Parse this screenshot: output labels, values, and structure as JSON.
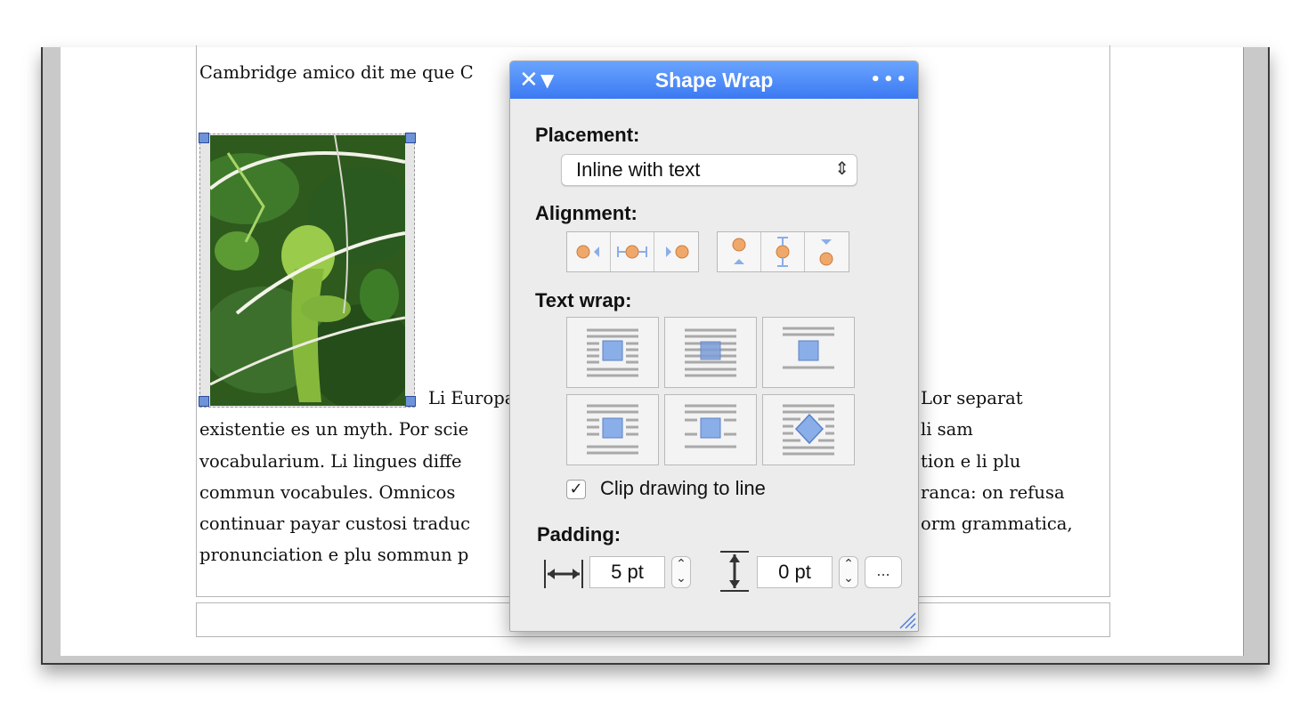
{
  "document": {
    "line_partial_top": "Cambridge amico dit me que C",
    "line_1": "Li Europa",
    "line_1_right": "Lor separat",
    "line_2": "existentie es un myth. Por scie",
    "line_2_right": "li sam",
    "line_3": "vocabularium. Li lingues diffe",
    "line_3_right": "tion e li plu",
    "line_4": "commun vocabules. Omnicos",
    "line_4_right": "ranca: on refusa",
    "line_5": "continuar payar custosi traduc",
    "line_5_right": "orm grammatica,",
    "line_6": "pronunciation e plu sommun p"
  },
  "palette": {
    "title": "Shape Wrap",
    "close_icon": "✕",
    "collapse_icon": "▼",
    "more_icon": "•••",
    "placement_label": "Placement:",
    "placement_value": "Inline with text",
    "alignment_label": "Alignment:",
    "text_wrap_label": "Text wrap:",
    "clip_label": "Clip drawing to line",
    "clip_checked": "✓",
    "padding_label": "Padding:",
    "padding_horizontal": "5 pt",
    "padding_vertical": "0 pt",
    "more_padding_label": "..."
  },
  "colors": {
    "titlebar": "#3b79f2",
    "selection_handle": "#6f93d8",
    "icon_blue": "#8aaee8",
    "icon_orange": "#f0a86a"
  },
  "icons": [
    "close-icon",
    "collapse-icon",
    "more-icon",
    "align-left-icon",
    "align-center-icon",
    "align-right-icon",
    "align-top-icon",
    "align-middle-icon",
    "align-bottom-icon",
    "wrap-square-icon",
    "wrap-inline-icon",
    "wrap-top-bottom-icon",
    "wrap-behind-icon",
    "wrap-front-icon",
    "wrap-tight-icon",
    "horizontal-padding-icon",
    "vertical-padding-icon",
    "resize-grip-icon"
  ]
}
